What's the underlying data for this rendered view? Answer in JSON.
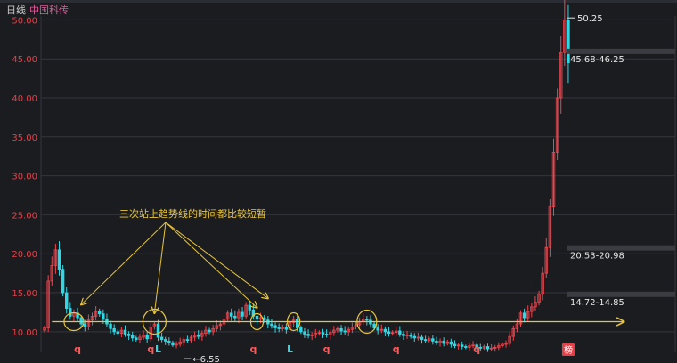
{
  "header": {
    "period": "日线",
    "stock_name": "中国科传"
  },
  "colors": {
    "background": "#1b1c20",
    "grid": "#34363c",
    "up": "#f0454e",
    "down": "#2fd8e4",
    "axis_label": "#e0424a",
    "annotation": "#e8c53a",
    "price_label": "#e6e6e6",
    "marker": "#ff5a5a",
    "badge_bg": "#e0424a"
  },
  "chart_data": {
    "type": "candlestick",
    "title": "",
    "xlabel": "",
    "ylabel": "",
    "ylim": [
      8.5,
      50.5
    ],
    "y_ticks": [
      "10.00",
      "15.00",
      "20.00",
      "25.00",
      "30.00",
      "35.00",
      "40.00",
      "45.00",
      "50.00"
    ],
    "grid": true,
    "price_labels": [
      {
        "text": "50.25",
        "price": 50.25
      },
      {
        "text": "45.68-46.25",
        "price": 45.95
      },
      {
        "text": "20.53-20.98",
        "price": 20.75
      },
      {
        "text": "14.72-14.85",
        "price": 14.8
      },
      {
        "text": "6.55",
        "price": 6.55
      }
    ],
    "trendline": {
      "price": 11.3,
      "label": "三次站上趋势线的时间都比较短暂"
    },
    "circled_candle_indexes": [
      8,
      30,
      58,
      68,
      88
    ],
    "bottom_markers": [
      {
        "text": "q",
        "index": 9
      },
      {
        "text": "q",
        "index": 29
      },
      {
        "text": "L",
        "index": 31
      },
      {
        "text": "q",
        "index": 57
      },
      {
        "text": "L",
        "index": 67
      },
      {
        "text": "q",
        "index": 77
      },
      {
        "text": "q",
        "index": 96
      },
      {
        "text": "q",
        "index": 118
      },
      {
        "text": "榜",
        "index": 143
      }
    ],
    "closes": [
      10.5,
      16.5,
      18.5,
      20.5,
      18.0,
      15.0,
      13.0,
      12.0,
      12.4,
      11.8,
      11.0,
      10.6,
      11.5,
      12.0,
      12.6,
      12.3,
      11.6,
      11.0,
      10.4,
      10.0,
      9.8,
      10.2,
      9.7,
      9.5,
      9.2,
      9.0,
      9.3,
      9.6,
      9.1,
      10.6,
      11.0,
      9.3,
      9.0,
      8.8,
      8.6,
      8.3,
      8.4,
      8.7,
      9.0,
      8.9,
      9.3,
      9.6,
      9.4,
      9.8,
      10.2,
      10.0,
      10.4,
      10.8,
      11.0,
      11.6,
      12.4,
      12.0,
      11.8,
      12.5,
      12.0,
      13.4,
      12.8,
      12.0,
      11.6,
      11.8,
      11.5,
      11.0,
      10.8,
      10.5,
      10.4,
      10.6,
      10.3,
      11.2,
      11.6,
      10.5,
      10.0,
      9.7,
      9.5,
      9.6,
      9.8,
      9.9,
      9.7,
      9.6,
      9.9,
      10.2,
      10.4,
      10.1,
      10.0,
      10.3,
      10.6,
      10.9,
      11.3,
      11.6,
      11.5,
      11.0,
      10.5,
      10.2,
      10.3,
      10.0,
      9.8,
      9.9,
      10.1,
      9.7,
      9.5,
      9.6,
      9.4,
      9.2,
      9.3,
      9.0,
      8.9,
      9.1,
      8.8,
      8.6,
      8.8,
      8.5,
      8.7,
      8.4,
      8.2,
      8.3,
      8.1,
      8.0,
      8.2,
      8.3,
      8.0,
      7.9,
      8.1,
      7.8,
      7.9,
      8.0,
      8.2,
      8.4,
      8.5,
      9.4,
      10.4,
      11.0,
      12.4,
      11.8,
      12.6,
      13.2,
      13.8,
      14.8,
      17.5,
      20.8,
      26.0,
      33.0,
      40.0,
      45.8,
      50.0,
      44.5
    ]
  }
}
